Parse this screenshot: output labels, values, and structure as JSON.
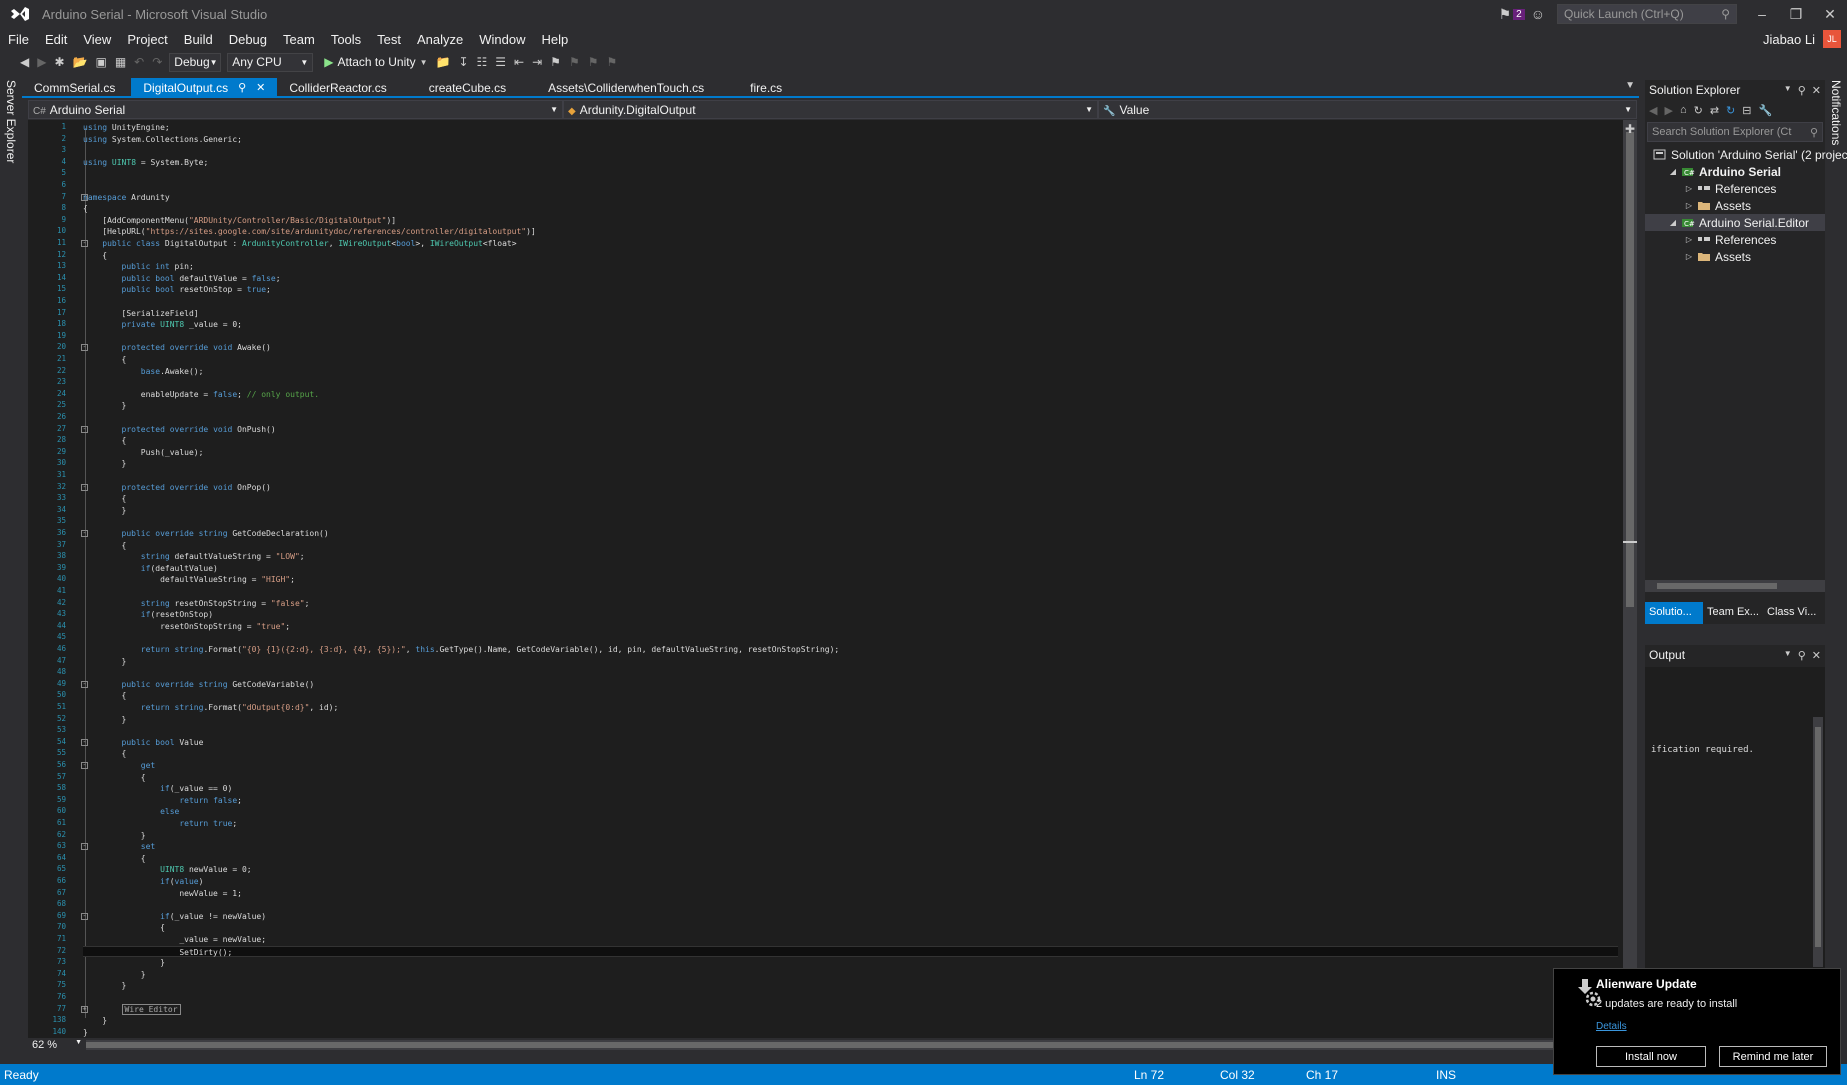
{
  "window": {
    "title": "Arduino Serial - Microsoft Visual Studio",
    "notifications_count": "2",
    "quick_launch_placeholder": "Quick Launch (Ctrl+Q)"
  },
  "menu": [
    "File",
    "Edit",
    "View",
    "Project",
    "Build",
    "Debug",
    "Team",
    "Tools",
    "Test",
    "Analyze",
    "Window",
    "Help"
  ],
  "user": {
    "name": "Jiabao Li",
    "initials": "JL"
  },
  "toolbar": {
    "config": "Debug",
    "platform": "Any CPU",
    "attach_label": "Attach to Unity"
  },
  "side_tabs": {
    "left": "Server Explorer",
    "right": "Notifications"
  },
  "doc_tabs": [
    {
      "label": "CommSerial.cs",
      "active": false
    },
    {
      "label": "DigitalOutput.cs",
      "active": true
    },
    {
      "label": "ColliderReactor.cs",
      "active": false
    },
    {
      "label": "createCube.cs",
      "active": false
    },
    {
      "label": "Assets\\ColliderwhenTouch.cs",
      "active": false
    },
    {
      "label": "fire.cs",
      "active": false
    }
  ],
  "nav": {
    "project": "Arduino Serial",
    "class": "Ardunity.DigitalOutput",
    "member": "Value"
  },
  "editor": {
    "line_numbers": [
      "1",
      "2",
      "3",
      "4",
      "5",
      "6",
      "7",
      "8",
      "9",
      "10",
      "11",
      "12",
      "13",
      "14",
      "15",
      "16",
      "17",
      "18",
      "19",
      "20",
      "21",
      "22",
      "23",
      "24",
      "25",
      "26",
      "27",
      "28",
      "29",
      "30",
      "31",
      "32",
      "33",
      "34",
      "35",
      "36",
      "37",
      "38",
      "39",
      "40",
      "41",
      "42",
      "43",
      "44",
      "45",
      "46",
      "47",
      "48",
      "49",
      "50",
      "51",
      "52",
      "53",
      "54",
      "55",
      "56",
      "57",
      "58",
      "59",
      "60",
      "61",
      "62",
      "63",
      "64",
      "65",
      "66",
      "67",
      "68",
      "69",
      "70",
      "71",
      "72",
      "73",
      "74",
      "75",
      "76",
      "77",
      "138",
      "140"
    ],
    "lines": [
      "using UnityEngine;",
      "using System.Collections.Generic;",
      "",
      "using UINT8 = System.Byte;",
      "",
      "",
      "namespace Ardunity",
      "{",
      "    [AddComponentMenu(\"ARDUnity/Controller/Basic/DigitalOutput\")]",
      "    [HelpURL(\"https://sites.google.com/site/ardunitydoc/references/controller/digitaloutput\")]",
      "    public class DigitalOutput : ArdunityController, IWireOutput<bool>, IWireOutput<float>",
      "    {",
      "        public int pin;",
      "        public bool defaultValue = false;",
      "        public bool resetOnStop = true;",
      "",
      "        [SerializeField]",
      "        private UINT8 _value = 0;",
      "",
      "        protected override void Awake()",
      "        {",
      "            base.Awake();",
      "",
      "            enableUpdate = false; // only output.",
      "        }",
      "",
      "        protected override void OnPush()",
      "        {",
      "            Push(_value);",
      "        }",
      "",
      "        protected override void OnPop()",
      "        {",
      "        }",
      "",
      "        public override string GetCodeDeclaration()",
      "        {",
      "            string defaultValueString = \"LOW\";",
      "            if(defaultValue)",
      "                defaultValueString = \"HIGH\";",
      "",
      "            string resetOnStopString = \"false\";",
      "            if(resetOnStop)",
      "                resetOnStopString = \"true\";",
      "",
      "            return string.Format(\"{0} {1}({2:d}, {3:d}, {4}, {5});\", this.GetType().Name, GetCodeVariable(), id, pin, defaultValueString, resetOnStopString);",
      "        }",
      "",
      "        public override string GetCodeVariable()",
      "        {",
      "            return string.Format(\"dOutput{0:d}\", id);",
      "        }",
      "",
      "        public bool Value",
      "        {",
      "            get",
      "            {",
      "                if(_value == 0)",
      "                    return false;",
      "                else",
      "                    return true;",
      "            }",
      "            set",
      "            {",
      "                UINT8 newValue = 0;",
      "                if(value)",
      "                    newValue = 1;",
      "",
      "                if(_value != newValue)",
      "                {",
      "                    _value = newValue;",
      "                    SetDirty();",
      "                }",
      "            }",
      "        }",
      "",
      "        Wire Editor",
      "    }",
      "}"
    ],
    "current_line_index": 71,
    "zoom": "62 %"
  },
  "solution_explorer": {
    "title": "Solution Explorer",
    "search_placeholder": "Search Solution Explorer (Ctrl+;)",
    "tree": [
      {
        "label": "Solution 'Arduino Serial' (2 projects)",
        "level": 0,
        "bold": false,
        "arrow": "",
        "icon": "solution"
      },
      {
        "label": "Arduino Serial",
        "level": 1,
        "bold": true,
        "arrow": "◢",
        "icon": "project"
      },
      {
        "label": "References",
        "level": 2,
        "bold": false,
        "arrow": "▷",
        "icon": "references"
      },
      {
        "label": "Assets",
        "level": 2,
        "bold": false,
        "arrow": "▷",
        "icon": "folder"
      },
      {
        "label": "Arduino Serial.Editor",
        "level": 1,
        "bold": false,
        "arrow": "◢",
        "icon": "project",
        "selected": true
      },
      {
        "label": "References",
        "level": 2,
        "bold": false,
        "arrow": "▷",
        "icon": "references"
      },
      {
        "label": "Assets",
        "level": 2,
        "bold": false,
        "arrow": "▷",
        "icon": "folder"
      }
    ],
    "bottom_tabs": [
      "Solutio...",
      "Team Ex...",
      "Class Vi..."
    ]
  },
  "output": {
    "title": "Output",
    "text": "ification required."
  },
  "toast": {
    "title": "Alienware Update",
    "message": "2 updates are ready to install",
    "details": "Details",
    "install": "Install now",
    "remind": "Remind me later"
  },
  "status": {
    "ready": "Ready",
    "ln": "Ln 72",
    "col": "Col 32",
    "ch": "Ch 17",
    "ins": "INS"
  },
  "colors": {
    "accent": "#007acc",
    "keyword": "#569cd6",
    "type": "#4ec9b0",
    "string": "#d69d85",
    "comment": "#57a64a",
    "line_number": "#2b91af"
  }
}
